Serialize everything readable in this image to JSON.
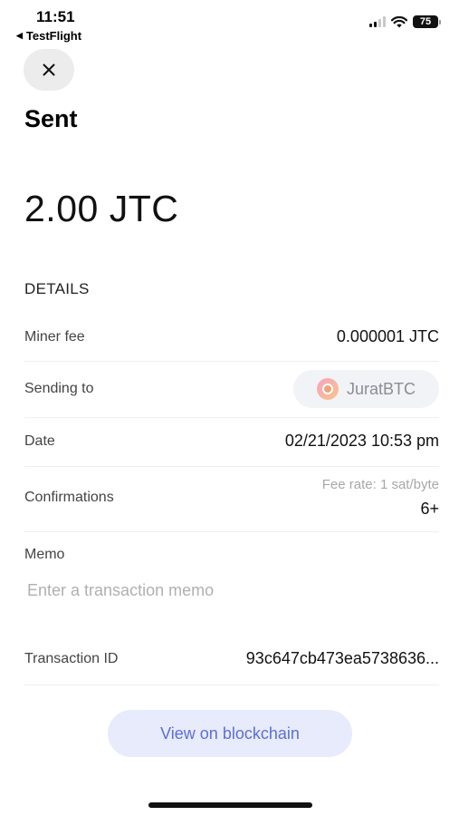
{
  "status_bar": {
    "time": "11:51",
    "back_app": "TestFlight",
    "battery": "75"
  },
  "header": {
    "title": "Sent"
  },
  "amount": "2.00 JTC",
  "details": {
    "section_label": "DETAILS",
    "miner_fee_label": "Miner fee",
    "miner_fee_value": "0.000001 JTC",
    "sending_to_label": "Sending to",
    "sending_to_value": "JuratBTC",
    "date_label": "Date",
    "date_value": "02/21/2023 10:53 pm",
    "confirmations_label": "Confirmations",
    "fee_rate": "Fee rate: 1 sat/byte",
    "confirmations_value": "6+",
    "memo_label": "Memo",
    "memo_placeholder": "Enter a transaction memo",
    "memo_value": "",
    "transaction_id_label": "Transaction ID",
    "transaction_id_value": "93c647cb473ea5738636..."
  },
  "actions": {
    "view_blockchain": "View on blockchain"
  },
  "icons": {
    "close": "close-icon",
    "avatar": "avatar-icon",
    "signal": "signal-icon",
    "wifi": "wifi-icon",
    "battery": "battery-icon"
  },
  "colors": {
    "accent": "#5a70d6",
    "accent_bg": "#e8ebfb",
    "chip_bg": "#f2f3f7"
  }
}
